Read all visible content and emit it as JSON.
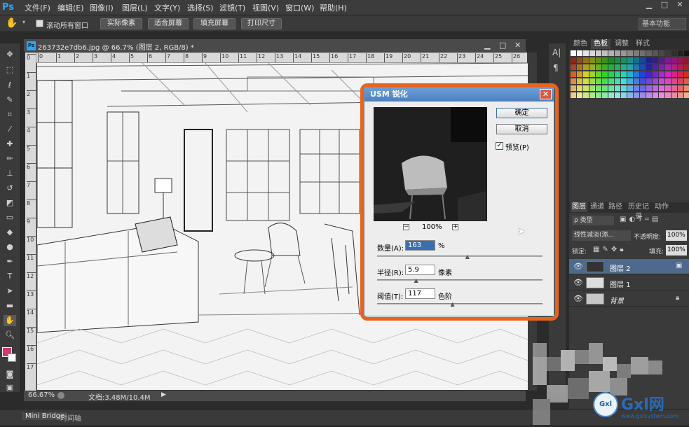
{
  "app": {
    "logo": "Ps",
    "menu": [
      "文件(F)",
      "编辑(E)",
      "图像(I)",
      "图层(L)",
      "文字(Y)",
      "选择(S)",
      "滤镜(T)",
      "视图(V)",
      "窗口(W)",
      "帮助(H)"
    ],
    "win_buttons": [
      "▁",
      "□",
      "✕"
    ]
  },
  "options": {
    "scroll_all": "滚动所有窗口",
    "buttons": [
      "实际像素",
      "适合屏幕",
      "填充屏幕",
      "打印尺寸"
    ],
    "workspace": "基本功能"
  },
  "document": {
    "tab_title": "263732e7db6.jpg @ 66.7% (图层 2, RGB/8) *",
    "zoom": "66.67%",
    "doc_info": "文档:3.48M/10.4M",
    "ruler_ticks": [
      "0",
      "1",
      "2",
      "3",
      "4",
      "5",
      "6",
      "7",
      "8",
      "9",
      "10",
      "11",
      "12",
      "13",
      "14",
      "15",
      "16",
      "17",
      "18",
      "19",
      "20",
      "21",
      "22",
      "23",
      "24",
      "25",
      "26"
    ]
  },
  "dialog": {
    "title": "USM 锐化",
    "ok": "确定",
    "cancel": "取消",
    "preview_label": "预览(P)",
    "preview_checked": true,
    "zoom": "100%",
    "zoom_out": "−",
    "zoom_in": "+",
    "amount_label": "数量(A):",
    "amount": "163",
    "amount_unit": "%",
    "amount_level": 0.55,
    "radius_label": "半径(R):",
    "radius": "5.9",
    "radius_unit": "像素",
    "radius_level": 0.24,
    "threshold_label": "阈值(T):",
    "threshold": "117",
    "threshold_unit": "色阶",
    "threshold_level": 0.46
  },
  "panels": {
    "swatch_tabs": [
      "颜色",
      "色板",
      "调整",
      "样式"
    ],
    "layer_tabs": [
      "图层",
      "通道",
      "路径",
      "历史记录",
      "动作"
    ],
    "kind_label": "ρ 类型",
    "blend_mode": "线性减淡(添...",
    "opacity_label": "不透明度:",
    "opacity": "100%",
    "lock_label": "锁定:",
    "fill_label": "填充:",
    "fill": "100%",
    "layers": [
      {
        "name": "图层 2",
        "selected": true
      },
      {
        "name": "图层 1",
        "selected": false
      },
      {
        "name": "背景",
        "selected": false,
        "locked": true
      }
    ]
  },
  "bottom": {
    "tabs": [
      "Mini Bridge",
      "时间轴"
    ]
  },
  "watermark": {
    "text": "Gxl网",
    "url": "www.gxlsystem.com"
  },
  "colors": {
    "fg": "#d2386a",
    "bg": "#ffffff",
    "accent": "#e8631e"
  }
}
